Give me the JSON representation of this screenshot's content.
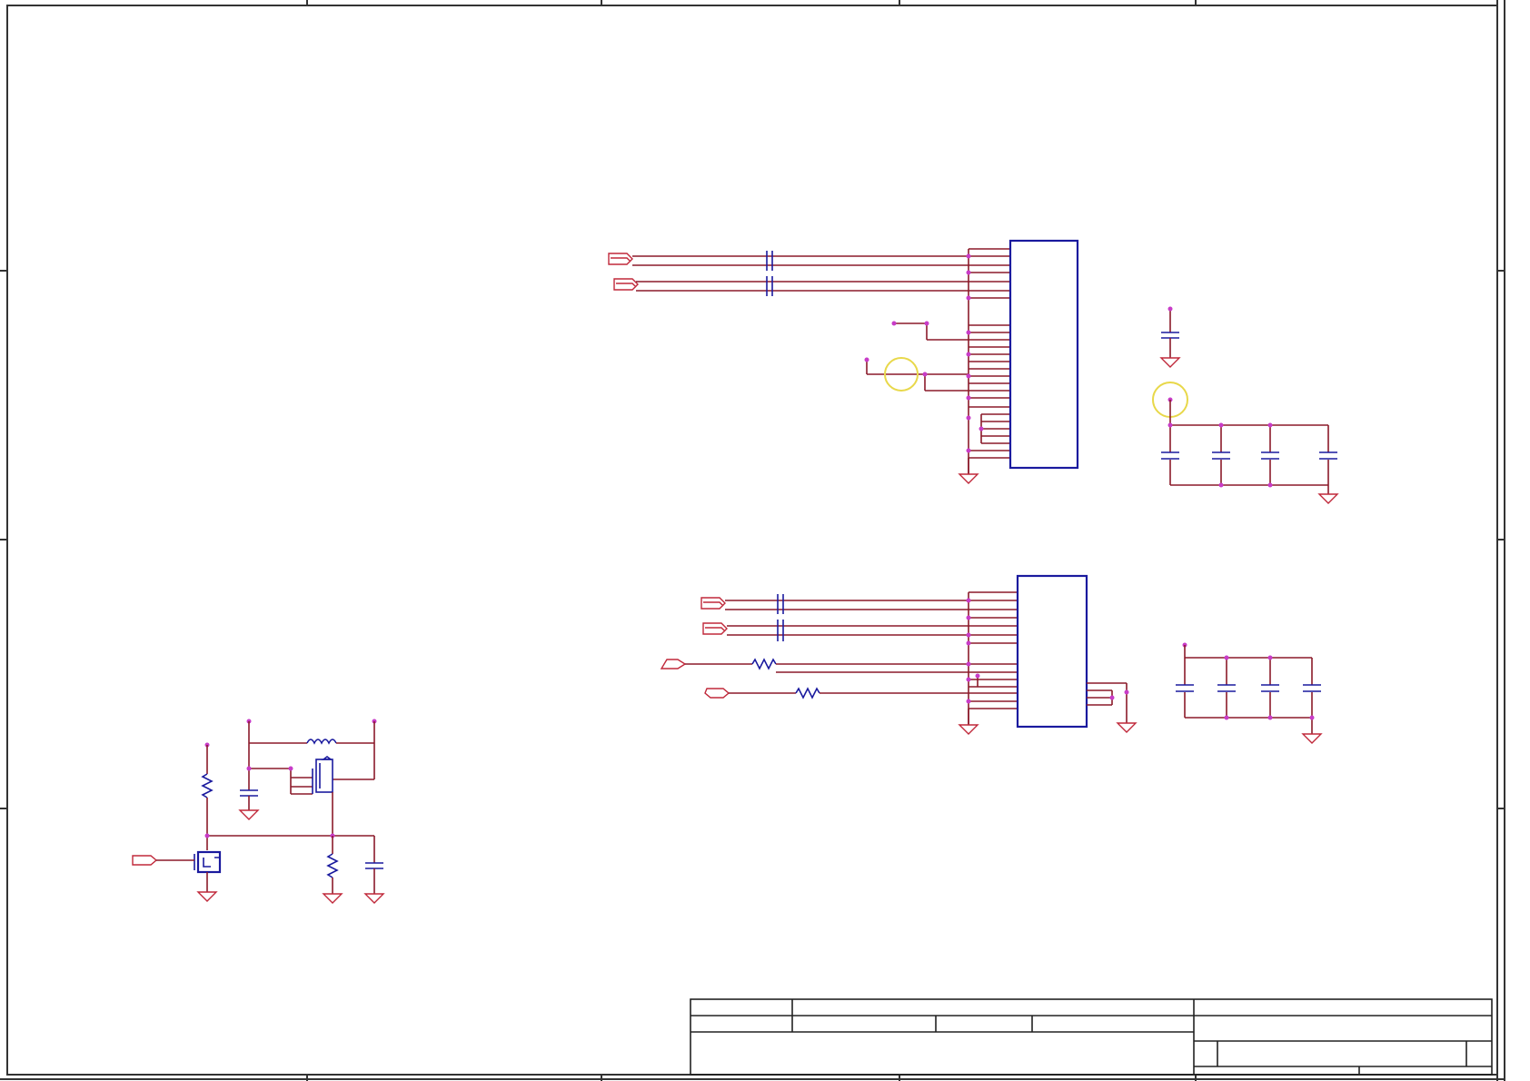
{
  "sheet": {
    "colors": {
      "wire": "#8b1a2a",
      "component": "#1a1a9e",
      "junction": "#c83cc8",
      "ground": "#c0283a",
      "highlight": "#e8d84a",
      "frame": "#333333"
    },
    "icons": [
      "ground-symbol-icon",
      "capacitor-icon",
      "resistor-icon",
      "inductor-icon",
      "mosfet-icon",
      "net-port-icon",
      "ic-chip-icon"
    ]
  }
}
